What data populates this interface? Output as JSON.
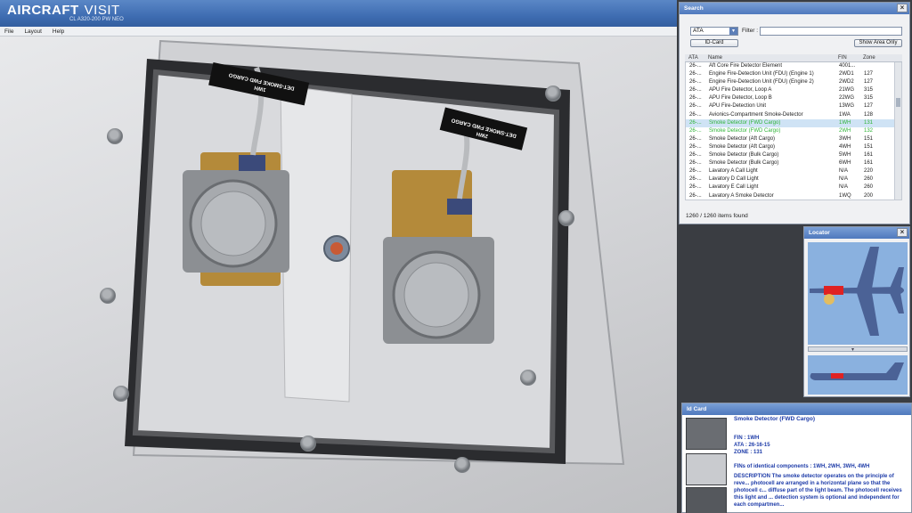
{
  "app": {
    "title_main": "AIRCRAFT",
    "title_accent": "VISIT",
    "subtitle": "CL A320-200 PW NEO"
  },
  "menu": [
    "File",
    "Layout",
    "Help"
  ],
  "scene": {
    "placard_left": "DET-SMOKE FWD CARGO",
    "placard_left_code": "1WH",
    "placard_right": "DET-SMOKE FWD CARGO",
    "placard_right_code": "2WH"
  },
  "search": {
    "title": "Search",
    "category": "ATA",
    "filter_label": "Filter :",
    "filter_value": "",
    "idcard_button": "ID-Card",
    "show_area_button": "Show Area Only",
    "columns": {
      "ata": "ATA",
      "name": "Name",
      "fin": "FIN",
      "zone": "Zone"
    },
    "rows": [
      {
        "ata": "26-...",
        "name": "Aft Core Fire Detector Element",
        "fin": "4001...",
        "zone": ""
      },
      {
        "ata": "26-...",
        "name": "Engine Fire-Detection Unit (FDU) (Engine 1)",
        "fin": "2WD1",
        "zone": "127"
      },
      {
        "ata": "26-...",
        "name": "Engine Fire-Detection Unit (FDU) (Engine 2)",
        "fin": "2WD2",
        "zone": "127"
      },
      {
        "ata": "26-...",
        "name": "APU Fire Detector, Loop A",
        "fin": "21WG",
        "zone": "315"
      },
      {
        "ata": "26-...",
        "name": "APU Fire Detector, Loop B",
        "fin": "22WG",
        "zone": "315"
      },
      {
        "ata": "26-...",
        "name": "APU Fire-Detection Unit",
        "fin": "13WG",
        "zone": "127"
      },
      {
        "ata": "26-...",
        "name": "Avionics-Compartment Smoke-Detector",
        "fin": "1WA",
        "zone": "128"
      },
      {
        "ata": "26-...",
        "name": "Smoke Detector (FWD Cargo)",
        "fin": "1WH",
        "zone": "131",
        "state": "selected"
      },
      {
        "ata": "26-...",
        "name": "Smoke Detector (FWD Cargo)",
        "fin": "2WH",
        "zone": "132",
        "state": "green"
      },
      {
        "ata": "26-...",
        "name": "Smoke Detector (Aft Cargo)",
        "fin": "3WH",
        "zone": "151"
      },
      {
        "ata": "26-...",
        "name": "Smoke Detector (Aft Cargo)",
        "fin": "4WH",
        "zone": "151"
      },
      {
        "ata": "26-...",
        "name": "Smoke Detector (Bulk Cargo)",
        "fin": "5WH",
        "zone": "161"
      },
      {
        "ata": "26-...",
        "name": "Smoke Detector (Bulk Cargo)",
        "fin": "6WH",
        "zone": "161"
      },
      {
        "ata": "26-...",
        "name": "Lavatory A Call Light",
        "fin": "N/A",
        "zone": "220"
      },
      {
        "ata": "26-...",
        "name": "Lavatory D Call Light",
        "fin": "N/A",
        "zone": "260"
      },
      {
        "ata": "26-...",
        "name": "Lavatory E Call Light",
        "fin": "N/A",
        "zone": "260"
      },
      {
        "ata": "26-...",
        "name": "Lavatory A Smoke Detector",
        "fin": "1WQ",
        "zone": "200"
      }
    ],
    "footer": "1260 / 1260 items found"
  },
  "locator": {
    "title": "Locator"
  },
  "idcard": {
    "title": "Id Card",
    "name": "Smoke Detector (FWD Cargo)",
    "fin": "FIN : 1WH",
    "ata": "ATA : 26-16-15",
    "zone": "ZONE : 131",
    "identical": "FINs of identical components : 1WH, 2WH, 3WH, 4WH",
    "description": "DESCRIPTION The smoke detector operates on the principle of reve... photocell are arranged in a horizontal plane so that the photocell c... diffuse part of the light beam. The photocell receives this light and ... detection system is optional and independent for each compartmen..."
  },
  "colors": {
    "header_blue": "#3f6db2",
    "selection": "#cfe3f5",
    "highlight_green": "#2fb338",
    "idcard_text": "#1d3ba8",
    "locator_bg": "#8ab1df"
  }
}
